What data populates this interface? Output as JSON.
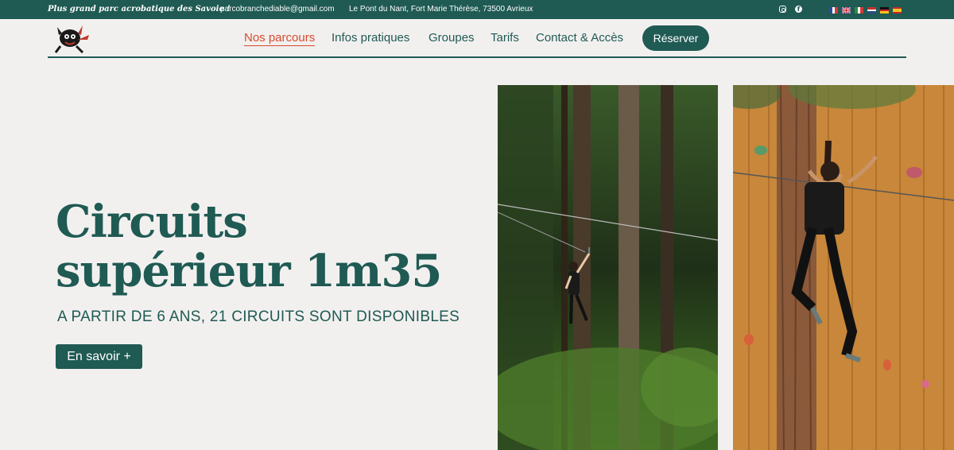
{
  "topbar": {
    "tagline": "Plus grand parc acrobatique des Savoie !",
    "email": "parcobranchediable@gmail.com",
    "address": "Le Pont du Nant, Fort Marie Thérèse, 73500 Avrieux",
    "social": [
      "instagram-icon",
      "facebook-icon"
    ],
    "flags": [
      "fr",
      "uk",
      "it",
      "nl",
      "de",
      "es"
    ]
  },
  "nav": {
    "items": [
      "Nos parcours",
      "Infos pratiques",
      "Groupes",
      "Tarifs",
      "Contact & Accès"
    ],
    "active": "Nos parcours",
    "reserve_label": "Réserver"
  },
  "hero": {
    "title_line1": "Circuits",
    "title_line2": "supérieur 1m35",
    "subtitle": "A PARTIR DE 6 ANS, 21 CIRCUITS SONT DISPONIBLES",
    "cta_label": "En savoir +"
  },
  "colors": {
    "primary": "#1f5a53",
    "accent": "#d84a2c",
    "background": "#f2f0ef"
  }
}
